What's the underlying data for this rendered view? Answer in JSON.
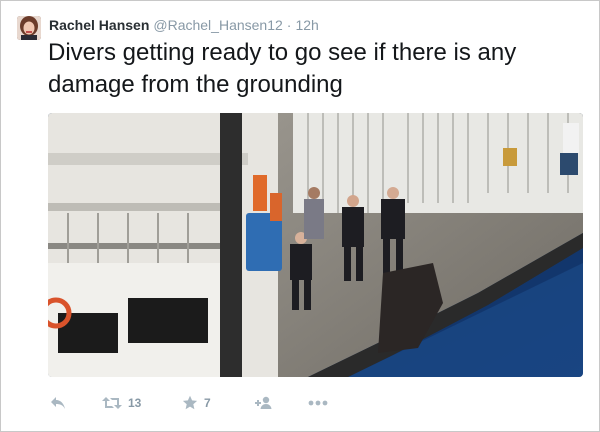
{
  "user": {
    "name": "Rachel Hansen",
    "handle": "@Rachel_Hansen12",
    "separator": "·",
    "time": "12h"
  },
  "tweet": {
    "text": "Divers getting ready to go see if there is any damage from the grounding"
  },
  "actions": {
    "retweets": "13",
    "likes": "7"
  },
  "icons": {
    "reply": "reply-icon",
    "retweet": "retweet-icon",
    "like": "star-icon",
    "follow": "follow-icon",
    "more": "more-icon"
  },
  "colors": {
    "text": "#14171a",
    "muted": "#8899a6",
    "icon": "#aab8c2"
  }
}
